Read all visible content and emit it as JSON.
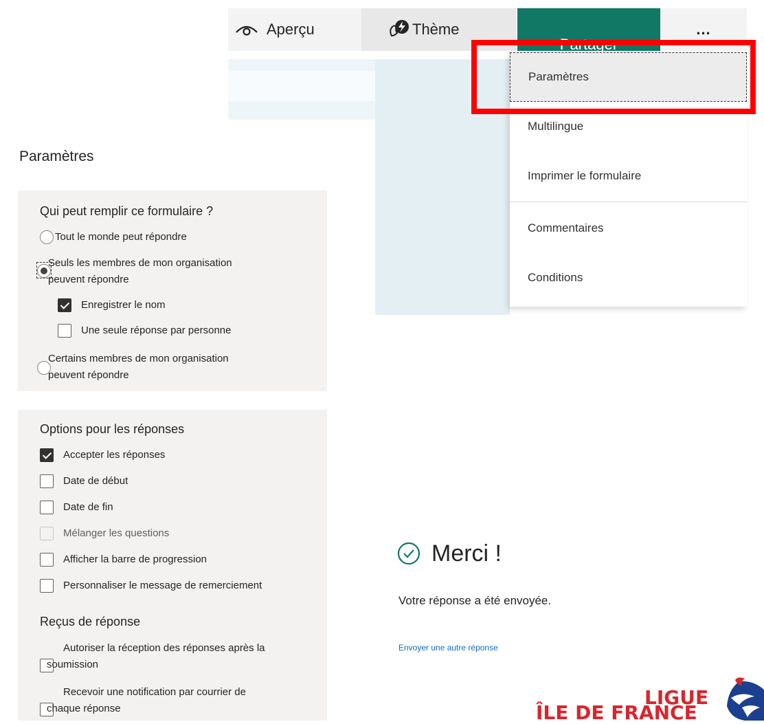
{
  "toolbar": {
    "preview_label": "Aperçu",
    "theme_label": "Thème",
    "share_label": "Partager",
    "more_label": "..."
  },
  "menu": {
    "items": [
      "Paramètres",
      "Multilingue",
      "Imprimer le formulaire",
      "Commentaires",
      "Conditions"
    ]
  },
  "settings": {
    "title": "Paramètres",
    "who": {
      "heading": "Qui peut remplir ce formulaire ?",
      "option_anyone": "Tout le monde peut répondre",
      "option_org_l1": "Seuls les membres de mon organisation",
      "option_org_l2": "peuvent répondre",
      "record_name": "Enregistrer le nom",
      "one_response": "Une seule réponse par personne",
      "option_some_l1": "Certains membres de mon organisation",
      "option_some_l2": "peuvent répondre"
    },
    "options": {
      "heading": "Options pour les réponses",
      "accept": "Accepter les réponses",
      "start_date": "Date de début",
      "end_date": "Date de fin",
      "shuffle": "Mélanger les questions",
      "progress": "Afficher la barre de progression",
      "custom_thanks": "Personnaliser le message de remerciement"
    },
    "receipts": {
      "heading": "Reçus de réponse",
      "receive_l1": "Autoriser la réception des réponses après la",
      "receive_l2": "soumission",
      "notify_l1": "Recevoir une notification par courrier de",
      "notify_l2": "chaque réponse"
    }
  },
  "thanks": {
    "title": "Merci !",
    "message": "Votre réponse a été envoyée.",
    "link": "Envoyer une autre réponse"
  },
  "logo": {
    "line1": "LIGUE",
    "line2": "ÎLE DE FRANCE"
  },
  "colors": {
    "share": "#117865",
    "highlight": "#ff0000",
    "link": "#0f6cbd",
    "logo": "#d8262e"
  }
}
